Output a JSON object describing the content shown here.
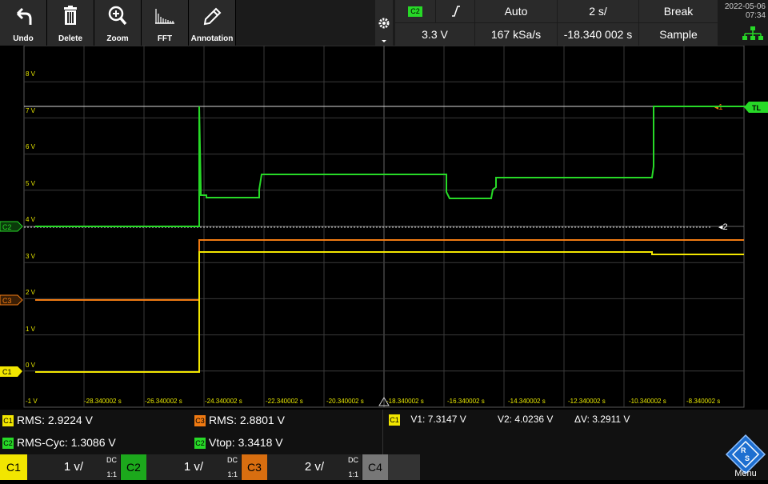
{
  "toolbar": {
    "buttons": [
      {
        "label": "Undo",
        "icon": "undo-icon"
      },
      {
        "label": "Delete",
        "icon": "trash-icon"
      },
      {
        "label": "Zoom",
        "icon": "zoom-icon"
      },
      {
        "label": "FFT",
        "icon": "fft-icon"
      },
      {
        "label": "Annotation",
        "icon": "pencil-icon"
      }
    ]
  },
  "trigger": {
    "source": "C2",
    "slope_icon": "rising-edge-icon",
    "mode": "Auto",
    "timebase": "2 s/",
    "run_state": "Break",
    "level": "3.3 V",
    "sample_rate": "167 kSa/s",
    "position": "-18.340 002 s",
    "acquisition": "Sample"
  },
  "clock": {
    "date": "2022-05-06",
    "time": "07:34"
  },
  "plot": {
    "y_ticks": [
      "8 V",
      "7 V",
      "6 V",
      "5 V",
      "4 V",
      "3 V",
      "2 V",
      "1 V",
      "0 V",
      "-1 V"
    ],
    "x_ticks": [
      "-28.340002 s",
      "-26.340002 s",
      "-24.340002 s",
      "-22.340002 s",
      "-20.340002 s",
      "-18.340002 s",
      "-16.340002 s",
      "-14.340002 s",
      "-12.340002 s",
      "-10.340002 s",
      "-8.340002 s"
    ],
    "marker_c1": "C1",
    "marker_c2": "C2",
    "marker_c3": "C3",
    "tl_label": "TL",
    "cursor_1": "1",
    "cursor_2": "2",
    "colors": {
      "c1": "#f2e600",
      "c2": "#27d927",
      "c3": "#f07a12",
      "grid": "#3a3a3a",
      "cursor": "#d8d8d8"
    }
  },
  "measurements": {
    "c1_rms": "RMS: 2.9224 V",
    "c3_rms": "RMS: 2.8801 V",
    "c2_rms_cyc": "RMS-Cyc: 1.3086 V",
    "c2_vtop": "Vtop: 3.3418 V",
    "cursor_v1": "V1: 7.3147 V",
    "cursor_v2": "V2: 4.0236 V",
    "cursor_dv": "ΔV: 3.2911 V"
  },
  "channels": [
    {
      "id": "C1",
      "scale": "1 v/",
      "coupling": "DC",
      "ratio": "1:1",
      "color": "#f2e600"
    },
    {
      "id": "C2",
      "scale": "1 v/",
      "coupling": "DC",
      "ratio": "1:1",
      "color": "#1ca81c"
    },
    {
      "id": "C3",
      "scale": "2 v/",
      "coupling": "DC",
      "ratio": "1:1",
      "color": "#d86e10"
    },
    {
      "id": "C4",
      "scale": "",
      "coupling": "",
      "ratio": "",
      "color": "#777777"
    }
  ],
  "menu_label": "Menu"
}
